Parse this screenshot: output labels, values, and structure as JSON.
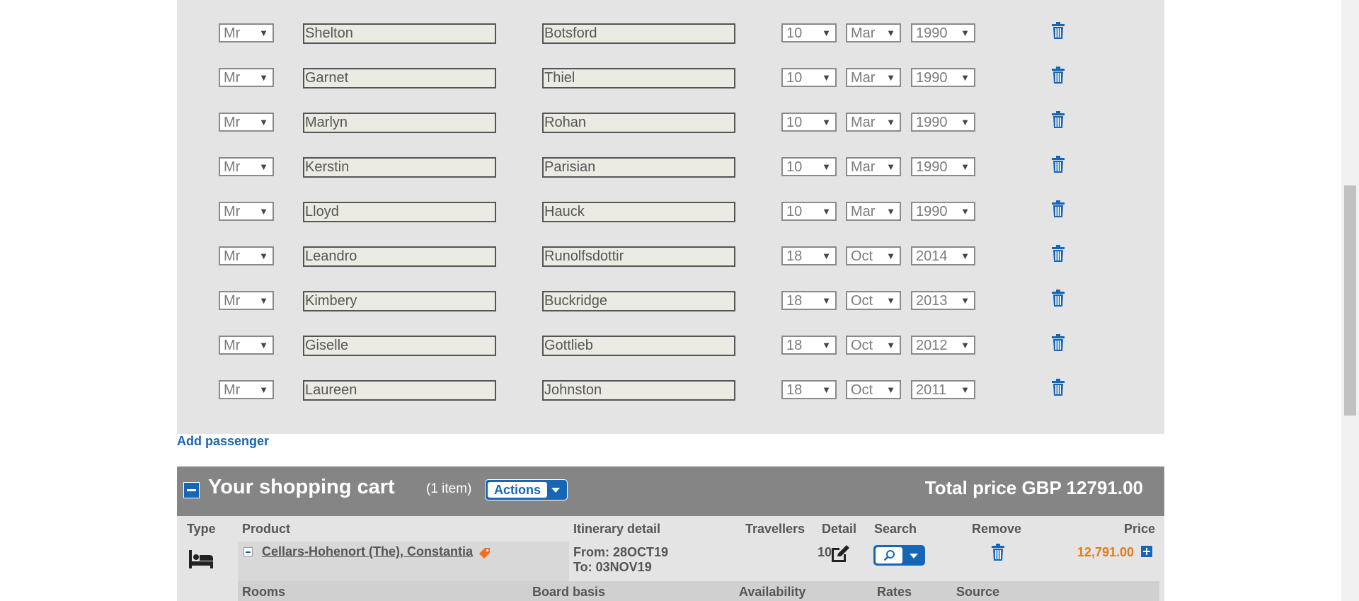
{
  "passengers": [
    {
      "title": "Mr",
      "first_name": "Shelton",
      "last_name": "Botsford",
      "day": "10",
      "month": "Mar",
      "year": "1990"
    },
    {
      "title": "Mr",
      "first_name": "Garnet",
      "last_name": "Thiel",
      "day": "10",
      "month": "Mar",
      "year": "1990"
    },
    {
      "title": "Mr",
      "first_name": "Marlyn",
      "last_name": "Rohan",
      "day": "10",
      "month": "Mar",
      "year": "1990"
    },
    {
      "title": "Mr",
      "first_name": "Kerstin",
      "last_name": "Parisian",
      "day": "10",
      "month": "Mar",
      "year": "1990"
    },
    {
      "title": "Mr",
      "first_name": "Lloyd",
      "last_name": "Hauck",
      "day": "10",
      "month": "Mar",
      "year": "1990"
    },
    {
      "title": "Mr",
      "first_name": "Leandro",
      "last_name": "Runolfsdottir",
      "day": "18",
      "month": "Oct",
      "year": "2014"
    },
    {
      "title": "Mr",
      "first_name": "Kimbery",
      "last_name": "Buckridge",
      "day": "18",
      "month": "Oct",
      "year": "2013"
    },
    {
      "title": "Mr",
      "first_name": "Giselle",
      "last_name": "Gottlieb",
      "day": "18",
      "month": "Oct",
      "year": "2012"
    },
    {
      "title": "Mr",
      "first_name": "Laureen",
      "last_name": "Johnston",
      "day": "18",
      "month": "Oct",
      "year": "2011"
    }
  ],
  "add_passenger_label": "Add passenger",
  "cart": {
    "title": "Your shopping cart",
    "item_count": "(1 item)",
    "actions_label": "Actions",
    "total_label": "Total price GBP 12791.00",
    "columns": {
      "type": "Type",
      "product": "Product",
      "itinerary": "Itinerary detail",
      "travellers": "Travellers",
      "detail": "Detail",
      "search": "Search",
      "remove": "Remove",
      "price": "Price"
    },
    "item": {
      "type_icon": "bed-icon",
      "product_name": "Cellars-Hohenort (The), Constantia",
      "tag_icon": "tag-icon",
      "from": "From: 28OCT19",
      "to": "To: 03NOV19",
      "travellers": "10",
      "price": "12,791.00"
    },
    "sub_columns": {
      "rooms": "Rooms",
      "board_basis": "Board basis",
      "availability": "Availability",
      "rates": "Rates",
      "source": "Source"
    }
  },
  "colors": {
    "accent": "#1566b7",
    "price": "#e07b1a",
    "panel": "#e4e4e4",
    "cart_header": "#858585"
  }
}
